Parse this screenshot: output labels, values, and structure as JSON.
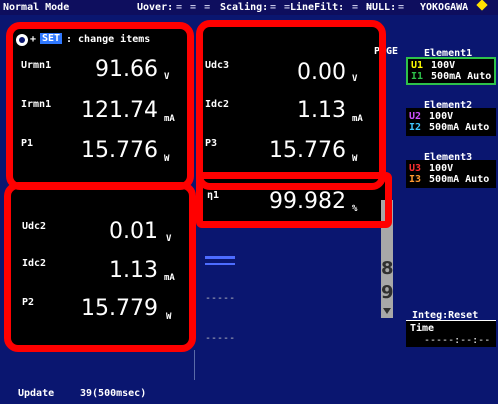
{
  "status_bar": {
    "mode": "Normal Mode",
    "uover": "Uover:",
    "uover_dashes": "= = =",
    "scaling": "Scaling:",
    "scaling_dashes": "= =",
    "linefilt": "LineFilt:",
    "linefilt_dashes": "= =",
    "null": "NULL:",
    "null_dashes": "=",
    "brand": "YOKOGAWA"
  },
  "set_hint": {
    "plus": "+",
    "set_key": "SET",
    "text": ": change items"
  },
  "panel1": {
    "rows": [
      {
        "label": "Urmn1",
        "value": "91.66",
        "unit": "V"
      },
      {
        "label": "Irmn1",
        "value": "121.74",
        "unit": "mA"
      },
      {
        "label": "P1",
        "value": "15.776",
        "unit": "W"
      }
    ]
  },
  "panel2": {
    "rows": [
      {
        "label": "Udc3",
        "value": "0.00",
        "unit": "V"
      },
      {
        "label": "Idc2",
        "value": "1.13",
        "unit": "mA"
      },
      {
        "label": "P3",
        "value": "15.776",
        "unit": "W"
      }
    ]
  },
  "panel3": {
    "rows": [
      {
        "label": "Udc2",
        "value": "0.01",
        "unit": "V"
      },
      {
        "label": "Idc2",
        "value": "1.13",
        "unit": "mA"
      },
      {
        "label": "P2",
        "value": "15.779",
        "unit": "W"
      }
    ]
  },
  "panel4": {
    "label": "η1",
    "value": "99.982",
    "unit": "%"
  },
  "dash_placeholder": "-----",
  "page_label": "PAGE",
  "scroll_numbers": [
    "8",
    "9"
  ],
  "elements": [
    {
      "title": "Element1",
      "u_tag": "U1",
      "u_range": "100V",
      "i_tag": "I1",
      "i_range": "500mA Auto",
      "u_color": "#ffff00",
      "i_color": "#2ec24a"
    },
    {
      "title": "Element2",
      "u_tag": "U2",
      "u_range": "100V",
      "i_tag": "I2",
      "i_range": "500mA Auto",
      "u_color": "#d050ff",
      "i_color": "#40c8ff"
    },
    {
      "title": "Element3",
      "u_tag": "U3",
      "u_range": "100V",
      "i_tag": "I3",
      "i_range": "500mA Auto",
      "u_color": "#ff3030",
      "i_color": "#ff9a30"
    }
  ],
  "integ": {
    "title": "Integ:Reset",
    "time_label": "Time",
    "time_value": "-----:--:--"
  },
  "footer": {
    "update_label": "Update",
    "update_value": "39(500msec)"
  },
  "colors": {
    "background": "#0a1670",
    "highlight_box": "#ff0000",
    "element_border": "#2ec24a",
    "brand_diamond": "#ffe100"
  }
}
